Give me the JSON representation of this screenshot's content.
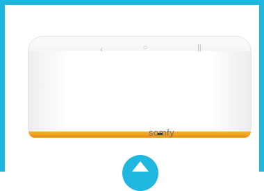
{
  "colors": {
    "frame": "#1fb6df",
    "device_body": "#ffffff",
    "strip": "#f2a126",
    "badge": "#1fb6df"
  },
  "device": {
    "brand_logo": "somfy",
    "button_marks": [
      "‹",
      "○",
      "||"
    ]
  },
  "icons": {
    "badge_icon": "up-arrow-icon"
  }
}
